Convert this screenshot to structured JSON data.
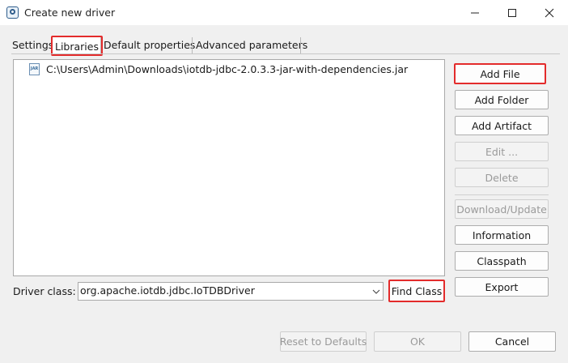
{
  "window": {
    "title": "Create new driver"
  },
  "tabs": [
    {
      "label": "Settings"
    },
    {
      "label": "Libraries"
    },
    {
      "label": "Default properties"
    },
    {
      "label": "Advanced parameters"
    }
  ],
  "libraries": [
    {
      "icon": "jar-file-icon",
      "icon_text": "JAR",
      "path": "C:\\Users\\Admin\\Downloads\\iotdb-jdbc-2.0.3.3-jar-with-dependencies.jar"
    }
  ],
  "buttons": {
    "add_file": "Add File",
    "add_folder": "Add Folder",
    "add_artifact": "Add Artifact",
    "edit": "Edit ...",
    "delete": "Delete",
    "download_update": "Download/Update",
    "information": "Information",
    "classpath": "Classpath",
    "export": "Export",
    "find_class": "Find Class",
    "reset_defaults": "Reset to Defaults",
    "ok": "OK",
    "cancel": "Cancel"
  },
  "driver_class": {
    "label": "Driver class:",
    "value": "org.apache.iotdb.jdbc.IoTDBDriver"
  },
  "colors": {
    "highlight": "#e32b2b",
    "window_bg": "#f0f0f0",
    "panel_bg": "#ffffff"
  }
}
